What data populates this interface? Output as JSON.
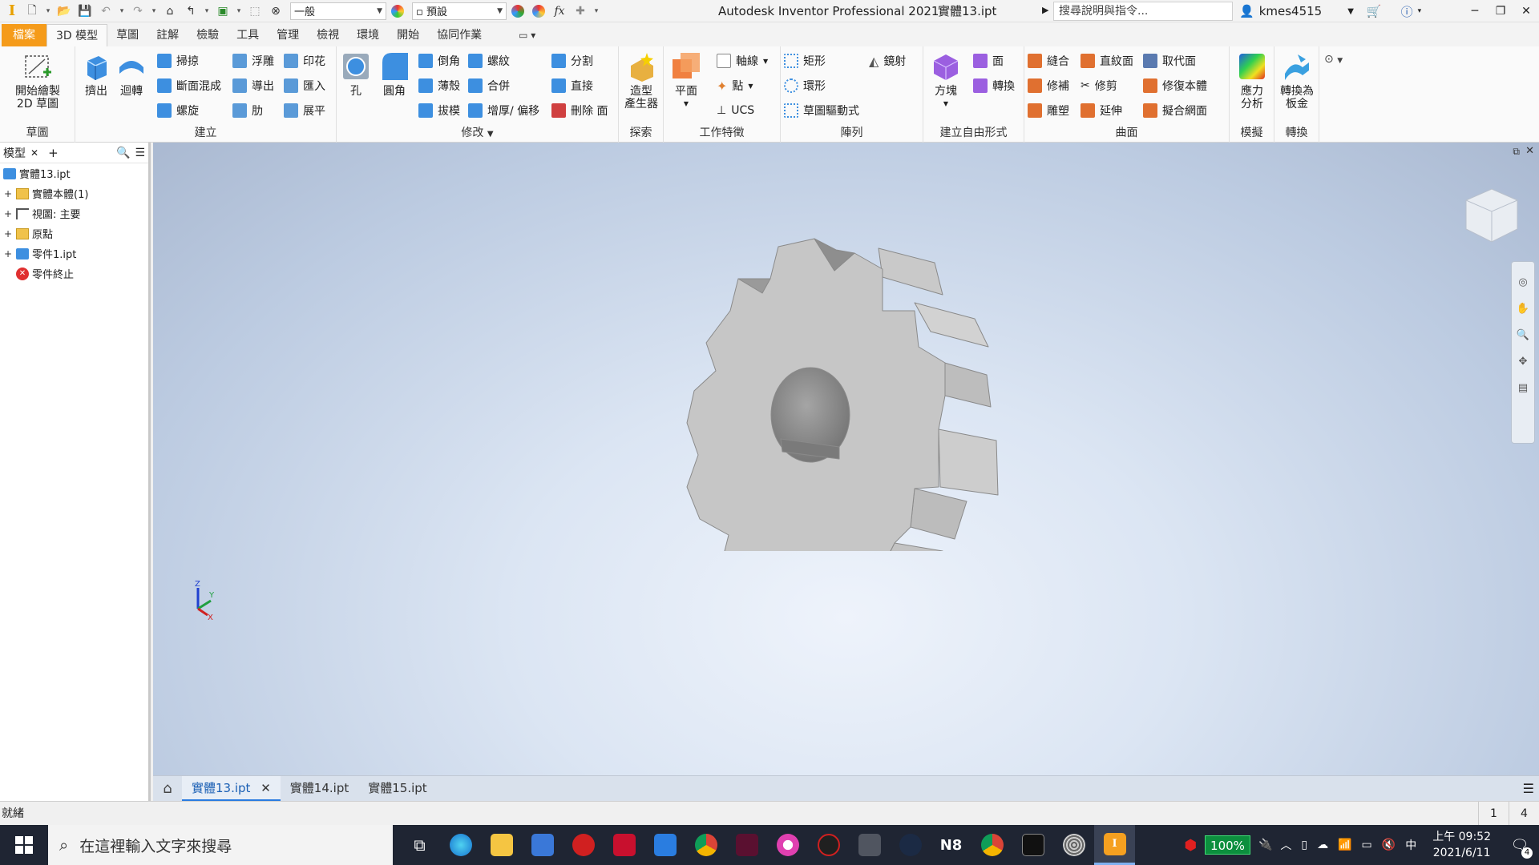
{
  "titlebar": {
    "app_title": "Autodesk Inventor Professional 2021",
    "doc_name": "實體13.ipt",
    "style_select": "一般",
    "appearance_select": "預設",
    "search_placeholder": "搜尋說明與指令...",
    "username": "kmes4515"
  },
  "tabs": [
    "檔案",
    "3D 模型",
    "草圖",
    "註解",
    "檢驗",
    "工具",
    "管理",
    "檢視",
    "環境",
    "開始",
    "協同作業"
  ],
  "ribbon": {
    "sketch": {
      "label": "草圖",
      "start_sketch": "開始繪製",
      "start_sketch2": "2D 草圖"
    },
    "create": {
      "label": "建立",
      "extrude": "擠出",
      "revolve": "迴轉",
      "sweep": "掃掠",
      "loft": "斷面混成",
      "coil": "螺旋",
      "emboss": "浮雕",
      "derive": "導出",
      "rib": "肋",
      "decal": "印花",
      "import": "匯入",
      "unwrap": "展平"
    },
    "modify": {
      "label": "修改",
      "hole": "孔",
      "fillet": "圓角",
      "chamfer": "倒角",
      "shell": "薄殼",
      "draft": "拔模",
      "thread": "螺紋",
      "combine": "合併",
      "thicken": "增厚/ 偏移",
      "split": "分割",
      "direct": "直接",
      "delete_face": "刪除 面"
    },
    "explore": {
      "label": "探索",
      "shape_gen": "造型",
      "shape_gen2": "產生器"
    },
    "work": {
      "label": "工作特徵",
      "plane": "平面",
      "axis": "軸線",
      "point": "點",
      "ucs": "UCS"
    },
    "pattern": {
      "label": "陣列",
      "rect": "矩形",
      "circ": "環形",
      "sketch_driven": "草圖驅動式",
      "mirror": "鏡射"
    },
    "freeform": {
      "label": "建立自由形式",
      "box": "方塊",
      "face": "面",
      "convert": "轉換"
    },
    "surface": {
      "label": "曲面",
      "stitch": "縫合",
      "patch": "修補",
      "sculpt": "雕塑",
      "ruled": "直紋面",
      "trim": "修剪",
      "extend": "延伸",
      "replace": "取代面",
      "repair": "修復本體",
      "fit_mesh": "擬合網面"
    },
    "simulation": {
      "label": "模擬",
      "stress": "應力",
      "stress2": "分析"
    },
    "convert": {
      "label": "轉換",
      "sheet": "轉換為",
      "sheet2": "板金"
    }
  },
  "browser": {
    "tab_label": "模型",
    "items": [
      {
        "label": "實體13.ipt",
        "level": 0,
        "icon": "part-icon"
      },
      {
        "label": "實體本體(1)",
        "level": 1,
        "icon": "folder-icon"
      },
      {
        "label": "視圖: 主要",
        "level": 1,
        "icon": "view-icon"
      },
      {
        "label": "原點",
        "level": 1,
        "icon": "folder-icon"
      },
      {
        "label": "零件1.ipt",
        "level": 1,
        "icon": "part-icon"
      },
      {
        "label": "零件終止",
        "level": 1,
        "icon": "end-of-part-icon"
      }
    ]
  },
  "triad": {
    "x": "X",
    "y": "Y",
    "z": "Z"
  },
  "doc_tabs": [
    "實體13.ipt",
    "實體14.ipt",
    "實體15.ipt"
  ],
  "status": {
    "text": "就緒",
    "num1": "1",
    "num2": "4"
  },
  "taskbar": {
    "search_placeholder": "在這裡輸入文字來搜尋",
    "battery": "100%",
    "ime": "中",
    "time": "上午 09:52",
    "date": "2021/6/11",
    "notifications": "4"
  },
  "colors": {
    "accent": "#f59b1a",
    "active_tab": "#2a7be0",
    "taskbar": "#1f2533"
  }
}
